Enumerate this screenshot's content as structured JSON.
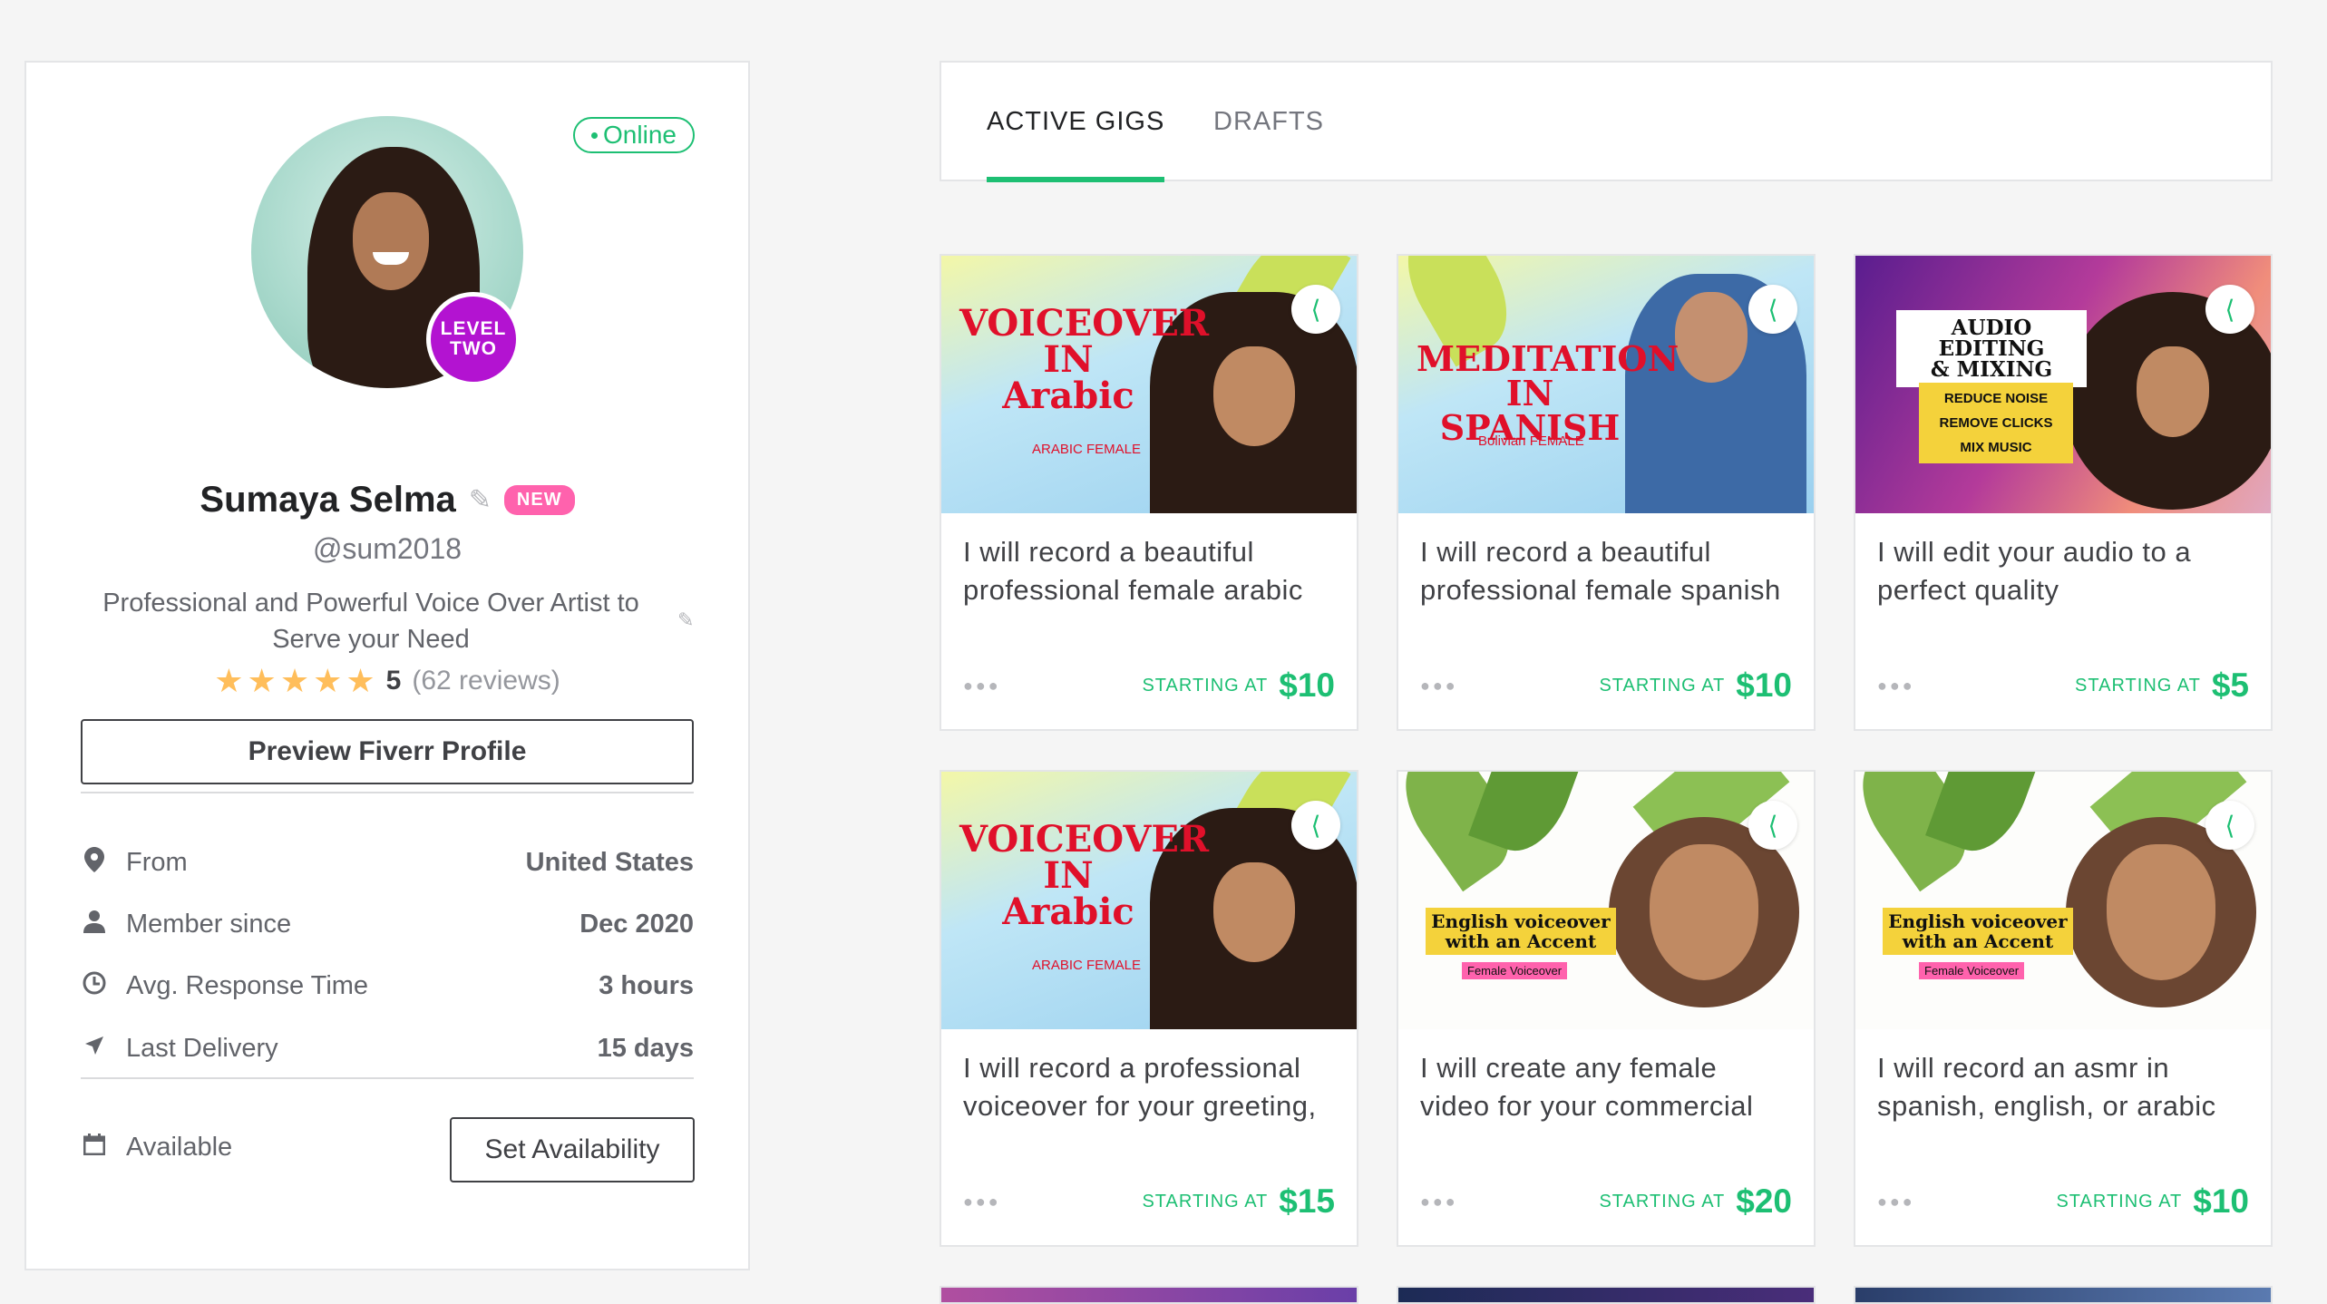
{
  "profile": {
    "online_label": "Online",
    "level_line1": "LEVEL",
    "level_line2": "TWO",
    "name": "Sumaya Selma",
    "new_badge": "NEW",
    "username": "@sum2018",
    "tagline": "Professional and Powerful Voice Over Artist to Serve your Need",
    "rating": "5",
    "reviews": "(62 reviews)",
    "preview_button": "Preview Fiverr Profile",
    "stats": [
      {
        "icon": "location-icon",
        "label": "From",
        "value": "United States"
      },
      {
        "icon": "user-icon",
        "label": "Member since",
        "value": "Dec 2020"
      },
      {
        "icon": "clock-icon",
        "label": "Avg. Response Time",
        "value": "3 hours"
      },
      {
        "icon": "send-icon",
        "label": "Last Delivery",
        "value": "15 days"
      }
    ],
    "availability_label": "Available",
    "set_availability_button": "Set Availability"
  },
  "tabs": [
    {
      "label": "ACTIVE GIGS",
      "active": true
    },
    {
      "label": "DRAFTS",
      "active": false
    }
  ],
  "starting_at_label": "STARTING AT",
  "gigs": [
    {
      "thumb": {
        "title_lines": [
          "VOICEOVER",
          "IN",
          "Arabic"
        ],
        "subtitle": "ARABIC FEMALE"
      },
      "title": "I will record a beautiful professional female arabic",
      "price": "$10"
    },
    {
      "thumb": {
        "title_lines": [
          "MEDITATION",
          "IN SPANISH"
        ],
        "subtitle": "Bolivian FEMALE"
      },
      "title": "I will record a beautiful professional female spanish",
      "price": "$10"
    },
    {
      "thumb": {
        "title_lines": [
          "AUDIO EDITING",
          "& MIXING"
        ],
        "bullets": [
          "REDUCE NOISE",
          "REMOVE CLICKS",
          "MIX MUSIC"
        ]
      },
      "title": "I will edit your audio to a perfect quality",
      "price": "$5"
    },
    {
      "thumb": {
        "title_lines": [
          "VOICEOVER",
          "IN",
          "Arabic"
        ],
        "subtitle": "ARABIC FEMALE"
      },
      "title": "I will record a professional voiceover for your greeting,",
      "price": "$15"
    },
    {
      "thumb": {
        "title_lines": [
          "English voiceover",
          "with an Accent"
        ],
        "subtitle": "Female Voiceover"
      },
      "title": "I will create any female video for your commercial",
      "price": "$20"
    },
    {
      "thumb": {
        "title_lines": [
          "English voiceover",
          "with an Accent"
        ],
        "subtitle": "Female Voiceover"
      },
      "title": "I will record an asmr in spanish, english, or arabic",
      "price": "$10"
    }
  ],
  "colors": {
    "accent": "#1dbf73",
    "new_badge": "#ff62ad",
    "level_badge": "#b313d1",
    "star": "#ffbe5b"
  }
}
